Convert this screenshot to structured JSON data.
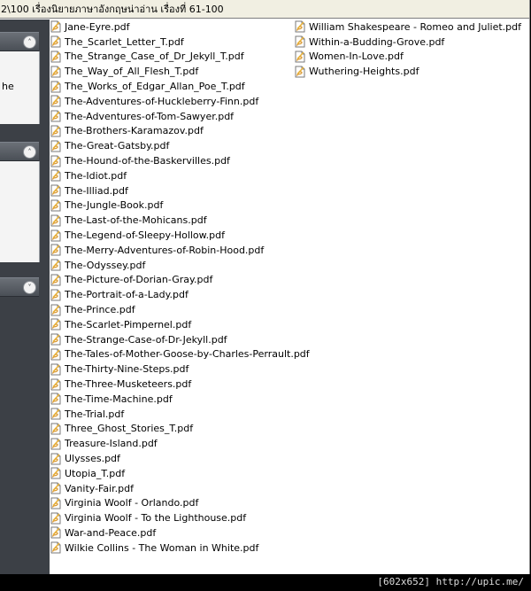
{
  "window": {
    "path": "2\\100 เรื่องนิยายภาษาอังกฤษน่าอ่าน เรื่องที่ 61-100"
  },
  "sidebar": {
    "panels": [
      {
        "toggle_icon": "chevron-up-icon",
        "snippet": "he"
      },
      {
        "toggle_icon": "chevron-up-icon",
        "snippet": ""
      },
      {
        "toggle_icon": "chevron-down-icon",
        "snippet": ""
      }
    ]
  },
  "files": {
    "icon": "pdf-file-icon",
    "column1": [
      "Jane-Eyre.pdf",
      "The_Scarlet_Letter_T.pdf",
      "The_Strange_Case_of_Dr_Jekyll_T.pdf",
      "The_Way_of_All_Flesh_T.pdf",
      "The_Works_of_Edgar_Allan_Poe_T.pdf",
      "The-Adventures-of-Huckleberry-Finn.pdf",
      "The-Adventures-of-Tom-Sawyer.pdf",
      "The-Brothers-Karamazov.pdf",
      "The-Great-Gatsby.pdf",
      "The-Hound-of-the-Baskervilles.pdf",
      "The-Idiot.pdf",
      "The-Illiad.pdf",
      "The-Jungle-Book.pdf",
      "The-Last-of-the-Mohicans.pdf",
      "The-Legend-of-Sleepy-Hollow.pdf",
      "The-Merry-Adventures-of-Robin-Hood.pdf",
      "The-Odyssey.pdf",
      "The-Picture-of-Dorian-Gray.pdf",
      "The-Portrait-of-a-Lady.pdf",
      "The-Prince.pdf",
      "The-Scarlet-Pimpernel.pdf",
      "The-Strange-Case-of-Dr-Jekyll.pdf",
      "The-Tales-of-Mother-Goose-by-Charles-Perrault.pdf",
      "The-Thirty-Nine-Steps.pdf",
      "The-Three-Musketeers.pdf",
      "The-Time-Machine.pdf",
      "The-Trial.pdf",
      "Three_Ghost_Stories_T.pdf",
      "Treasure-Island.pdf",
      "Ulysses.pdf",
      "Utopia_T.pdf",
      "Vanity-Fair.pdf",
      "Virginia Woolf - Orlando.pdf",
      "Virginia Woolf - To the Lighthouse.pdf",
      "War-and-Peace.pdf",
      "Wilkie Collins - The Woman in White.pdf"
    ],
    "column2": [
      "William Shakespeare - Romeo and Juliet.pdf",
      "Within-a-Budding-Grove.pdf",
      "Women-In-Love.pdf",
      "Wuthering-Heights.pdf"
    ]
  },
  "status": {
    "text": "[602x652] http://upic.me/"
  }
}
